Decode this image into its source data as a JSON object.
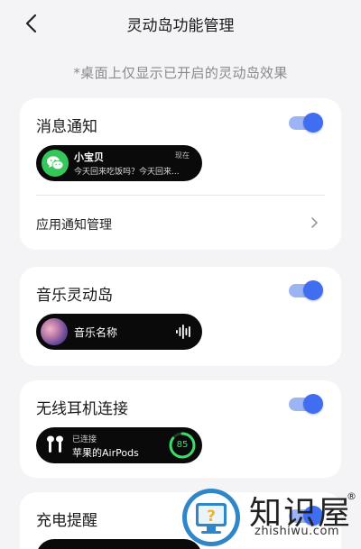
{
  "header": {
    "title": "灵动岛功能管理",
    "back_icon": "chevron-left-icon"
  },
  "subtitle": "*桌面上仅显示已开启的灵动岛效果",
  "accent_color": "#3f6ef0",
  "cards": {
    "message": {
      "title": "消息通知",
      "enabled": true,
      "preview": {
        "icon": "wechat-icon",
        "sender": "小宝贝",
        "time": "现在",
        "text": "今天回来吃饭吗？今天回来..."
      },
      "row_label": "应用通知管理",
      "row_icon": "chevron-right-icon"
    },
    "music": {
      "title": "音乐灵动岛",
      "enabled": true,
      "preview": {
        "icon": "album-cover",
        "song": "音乐名称",
        "wave_icon": "sound-wave-icon"
      }
    },
    "earphone": {
      "title": "无线耳机连接",
      "enabled": true,
      "preview": {
        "icon": "airpods-icon",
        "status": "已连接",
        "device": "苹果的AirPods",
        "battery": "85",
        "battery_percent": 85
      }
    },
    "charging": {
      "title": "充电提醒",
      "enabled": true
    }
  },
  "watermark": {
    "name": "知识屋",
    "url": "zhishiwu.com",
    "reg": "®"
  }
}
